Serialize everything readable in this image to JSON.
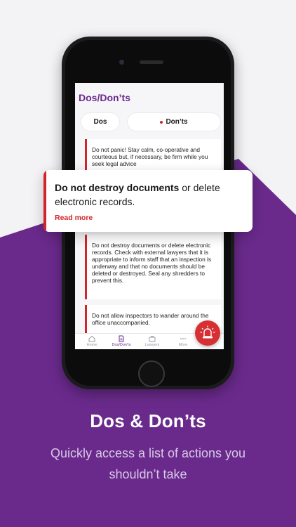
{
  "screen": {
    "title": "Dos/Don’ts",
    "segments": {
      "dos": "Dos",
      "donts": "Don’ts"
    },
    "cards": [
      "Do not panic! Stay calm, co-operative and courteous but, if necessary, be firm while you seek legal advice",
      "Do not destroy documents or delete electronic records. Check with external lawyers that it is appropriate to inform staff that an inspection is underway and that no documents should be deleted or destroyed. Seal any shredders to prevent this.",
      "Do not allow inspectors to wander around the office unaccompanied."
    ],
    "tabs": [
      {
        "label": "Home",
        "icon": "home-icon"
      },
      {
        "label": "Dos/Don’ts",
        "icon": "document-icon"
      },
      {
        "label": "Lawyers",
        "icon": "briefcase-icon"
      },
      {
        "label": "More",
        "icon": "more-icon"
      }
    ]
  },
  "popup": {
    "bold": "Do not destroy documents",
    "rest": " or delete electronic records.",
    "link": "Read more"
  },
  "promo": {
    "headline": "Dos & Don’ts",
    "subline": "Quickly access a list of actions you shouldn’t take"
  },
  "colors": {
    "brand_purple": "#6a2a8c",
    "accent_red": "#d0252b",
    "background": "#f3f2f4"
  }
}
